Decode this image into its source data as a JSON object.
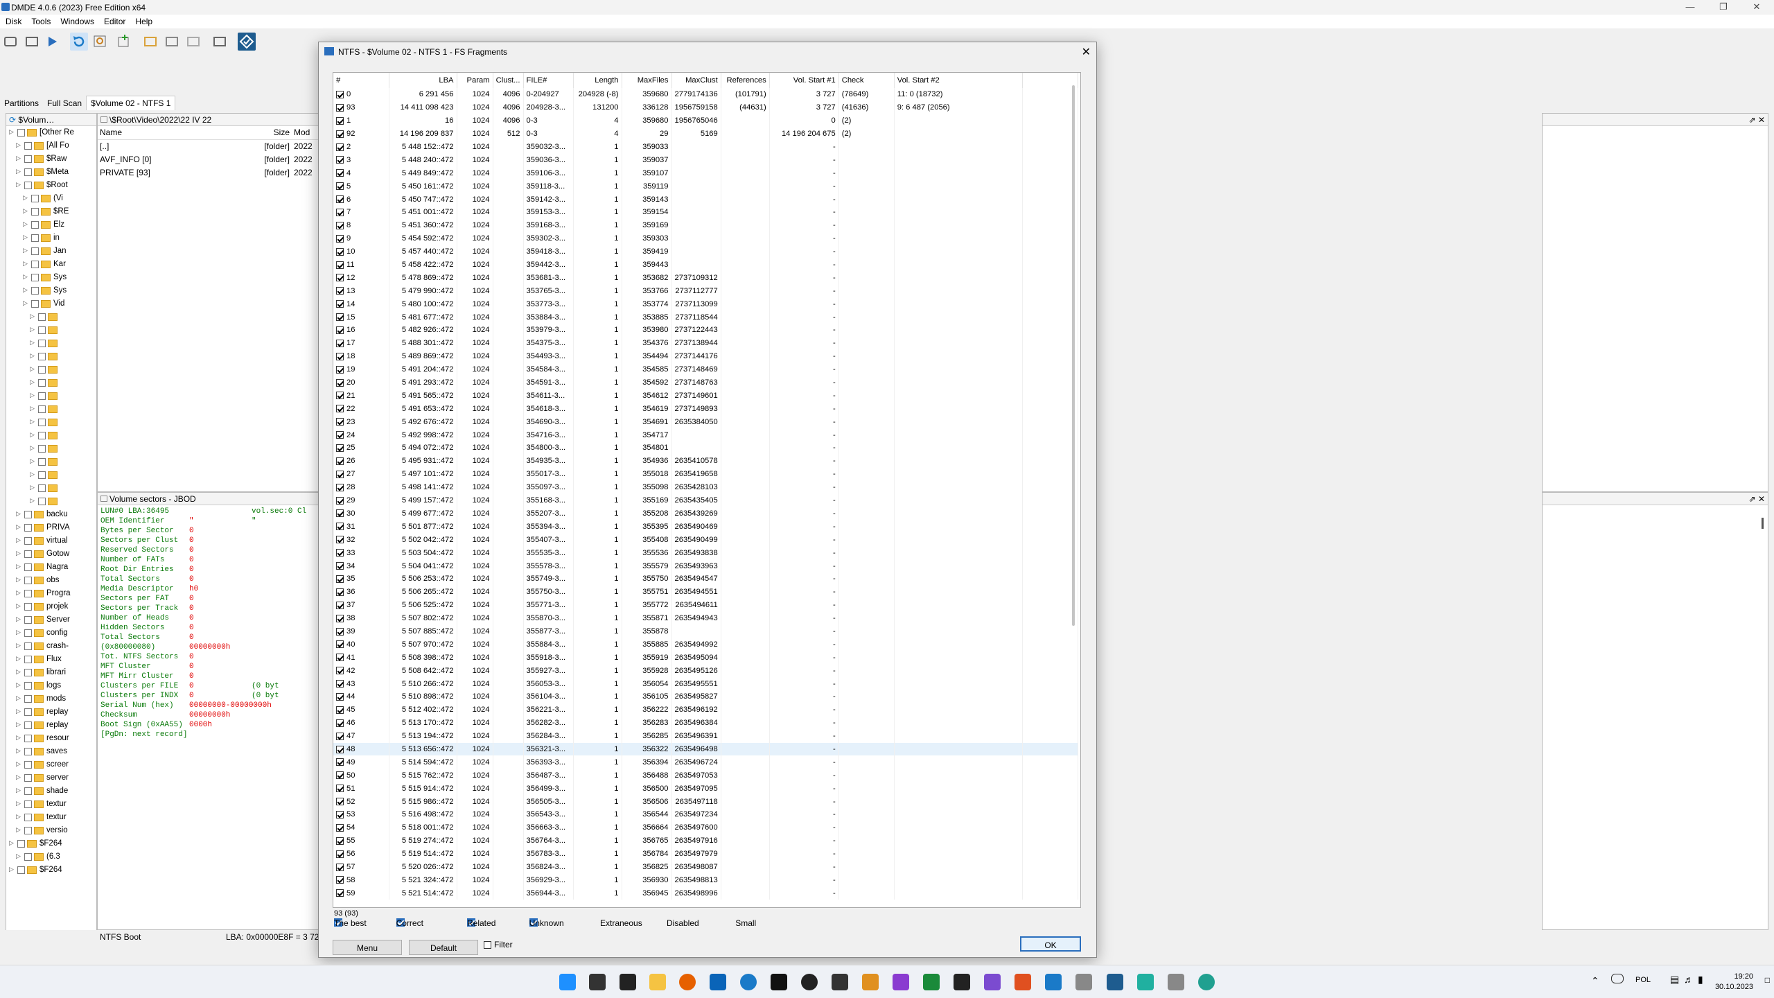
{
  "app": {
    "title": "DMDE 4.0.6 (2023) Free Edition x64"
  },
  "menu": [
    "Disk",
    "Tools",
    "Windows",
    "Editor",
    "Help"
  ],
  "tabs": [
    "Partitions",
    "Full Scan",
    "$Volume 02 - NTFS 1"
  ],
  "tree": {
    "header": "$Volum…",
    "rows": [
      {
        "i": 0,
        "t": "[Other Re"
      },
      {
        "i": 1,
        "t": "[All Fo"
      },
      {
        "i": 1,
        "t": "$Raw"
      },
      {
        "i": 1,
        "t": "$Meta"
      },
      {
        "i": 1,
        "t": "$Root"
      },
      {
        "i": 2,
        "t": "(Vi"
      },
      {
        "i": 2,
        "t": "$RE"
      },
      {
        "i": 2,
        "t": "Elz"
      },
      {
        "i": 2,
        "t": "in"
      },
      {
        "i": 2,
        "t": "Jan"
      },
      {
        "i": 2,
        "t": "Kar"
      },
      {
        "i": 2,
        "t": "Sys"
      },
      {
        "i": 2,
        "t": "Sys"
      },
      {
        "i": 2,
        "t": "Vid"
      },
      {
        "i": 3,
        "t": ""
      },
      {
        "i": 3,
        "t": ""
      },
      {
        "i": 3,
        "t": ""
      },
      {
        "i": 3,
        "t": ""
      },
      {
        "i": 3,
        "t": ""
      },
      {
        "i": 3,
        "t": ""
      },
      {
        "i": 3,
        "t": ""
      },
      {
        "i": 3,
        "t": ""
      },
      {
        "i": 3,
        "t": ""
      },
      {
        "i": 3,
        "t": ""
      },
      {
        "i": 3,
        "t": ""
      },
      {
        "i": 3,
        "t": ""
      },
      {
        "i": 3,
        "t": ""
      },
      {
        "i": 3,
        "t": ""
      },
      {
        "i": 3,
        "t": ""
      },
      {
        "i": 1,
        "t": "backu"
      },
      {
        "i": 1,
        "t": "PRIVA"
      },
      {
        "i": 1,
        "t": "virtual"
      },
      {
        "i": 1,
        "t": "Gotow"
      },
      {
        "i": 1,
        "t": "Nagra"
      },
      {
        "i": 1,
        "t": "obs"
      },
      {
        "i": 1,
        "t": "Progra"
      },
      {
        "i": 1,
        "t": "projek"
      },
      {
        "i": 1,
        "t": "Server"
      },
      {
        "i": 1,
        "t": "config"
      },
      {
        "i": 1,
        "t": "crash-"
      },
      {
        "i": 1,
        "t": "Flux"
      },
      {
        "i": 1,
        "t": "librari"
      },
      {
        "i": 1,
        "t": "logs"
      },
      {
        "i": 1,
        "t": "mods"
      },
      {
        "i": 1,
        "t": "replay"
      },
      {
        "i": 1,
        "t": "replay"
      },
      {
        "i": 1,
        "t": "resour"
      },
      {
        "i": 1,
        "t": "saves"
      },
      {
        "i": 1,
        "t": "screer"
      },
      {
        "i": 1,
        "t": "server"
      },
      {
        "i": 1,
        "t": "shade"
      },
      {
        "i": 1,
        "t": "textur"
      },
      {
        "i": 1,
        "t": "textur"
      },
      {
        "i": 1,
        "t": "versio"
      },
      {
        "i": 0,
        "t": "$F264"
      },
      {
        "i": 1,
        "t": "(6.3"
      },
      {
        "i": 0,
        "t": "$F264"
      }
    ]
  },
  "files": {
    "path": "\\$Root\\Video\\2022\\22 IV 22",
    "cols": [
      "Name",
      "Size",
      "Mod"
    ],
    "rows": [
      {
        "name": "[..]",
        "size": "[folder]",
        "mod": "2022"
      },
      {
        "name": "AVF_INFO [0]",
        "size": "[folder]",
        "mod": "2022"
      },
      {
        "name": "PRIVATE [93]",
        "size": "[folder]",
        "mod": "2022"
      }
    ]
  },
  "sectors": {
    "title": "Volume sectors - JBOD",
    "lines": [
      {
        "a": "LUN#0 LBA:36495",
        "b": "",
        "c": "vol.sec:0 Cl"
      },
      {
        "a": "OEM Identifier",
        "b": "\"",
        "c": "\""
      },
      {
        "a": "Bytes per Sector",
        "b": "0",
        "c": ""
      },
      {
        "a": "Sectors per Clust",
        "b": "0",
        "c": ""
      },
      {
        "a": "Reserved Sectors",
        "b": "0",
        "c": ""
      },
      {
        "a": "Number of FATs",
        "b": "0",
        "c": ""
      },
      {
        "a": "Root Dir Entries",
        "b": "0",
        "c": ""
      },
      {
        "a": "Total Sectors",
        "b": "0",
        "c": ""
      },
      {
        "a": "Media Descriptor",
        "b": "h0",
        "c": ""
      },
      {
        "a": "Sectors per FAT",
        "b": "0",
        "c": ""
      },
      {
        "a": "Sectors per Track",
        "b": "0",
        "c": ""
      },
      {
        "a": "Number of Heads",
        "b": "0",
        "c": ""
      },
      {
        "a": "Hidden Sectors",
        "b": "0",
        "c": ""
      },
      {
        "a": "Total Sectors",
        "b": "0",
        "c": ""
      },
      {
        "a": "(0x80000080)",
        "b": "00000000h",
        "c": ""
      },
      {
        "a": "Tot. NTFS Sectors",
        "b": "0",
        "c": ""
      },
      {
        "a": "MFT Cluster",
        "b": "0",
        "c": ""
      },
      {
        "a": "MFT Mirr Cluster",
        "b": "0",
        "c": ""
      },
      {
        "a": "Clusters per FILE",
        "b": "0",
        "c": "(0 byt"
      },
      {
        "a": "Clusters per INDX",
        "b": "0",
        "c": "(0 byt"
      },
      {
        "a": "Serial Num (hex)",
        "b": "00000000-00000000h",
        "c": ""
      },
      {
        "a": "Checksum",
        "b": "00000000h",
        "c": ""
      },
      {
        "a": "Boot Sign (0xAA55)",
        "b": "0000h",
        "c": ""
      },
      {
        "a": "[PgDn: next record]",
        "b": "",
        "c": ""
      }
    ]
  },
  "statusbar": {
    "left": "NTFS Boot",
    "mid": "LBA: 0x00000E8F = 3 727"
  },
  "dialog": {
    "title": "NTFS - $Volume 02 - NTFS 1 - FS Fragments",
    "cols": [
      "#",
      "LBA",
      "Param",
      "Clust...",
      "FILE#",
      "Length",
      "MaxFiles",
      "MaxClust",
      "References",
      "Vol. Start #1",
      "Check",
      "Vol. Start #2"
    ],
    "rows": [
      [
        "0",
        "6 291 456",
        "1024",
        "4096",
        "0-204927",
        "204928 (-8)",
        "359680",
        "2779174136",
        "(101791)",
        "3 727",
        "(78649)",
        "11: 0 (18732)"
      ],
      [
        "93",
        "14 411 098 423",
        "1024",
        "4096",
        "204928-3...",
        "131200",
        "336128",
        "1956759158",
        "(44631)",
        "3 727",
        "(41636)",
        "9: 6 487 (2056)"
      ],
      [
        "1",
        "16",
        "1024",
        "4096",
        "0-3",
        "4",
        "359680",
        "1956765046",
        "",
        "0",
        "(2)",
        ""
      ],
      [
        "92",
        "14 196 209 837",
        "1024",
        "512",
        "0-3",
        "4",
        "29",
        "5169",
        "",
        "14 196 204 675",
        "(2)",
        ""
      ],
      [
        "2",
        "5 448 152::472",
        "1024",
        "",
        "359032-3...",
        "1",
        "359033",
        "",
        "",
        "-",
        "",
        ""
      ],
      [
        "3",
        "5 448 240::472",
        "1024",
        "",
        "359036-3...",
        "1",
        "359037",
        "",
        "",
        "-",
        "",
        ""
      ],
      [
        "4",
        "5 449 849::472",
        "1024",
        "",
        "359106-3...",
        "1",
        "359107",
        "",
        "",
        "-",
        "",
        ""
      ],
      [
        "5",
        "5 450 161::472",
        "1024",
        "",
        "359118-3...",
        "1",
        "359119",
        "",
        "",
        "-",
        "",
        ""
      ],
      [
        "6",
        "5 450 747::472",
        "1024",
        "",
        "359142-3...",
        "1",
        "359143",
        "",
        "",
        "-",
        "",
        ""
      ],
      [
        "7",
        "5 451 001::472",
        "1024",
        "",
        "359153-3...",
        "1",
        "359154",
        "",
        "",
        "-",
        "",
        ""
      ],
      [
        "8",
        "5 451 360::472",
        "1024",
        "",
        "359168-3...",
        "1",
        "359169",
        "",
        "",
        "-",
        "",
        ""
      ],
      [
        "9",
        "5 454 592::472",
        "1024",
        "",
        "359302-3...",
        "1",
        "359303",
        "",
        "",
        "-",
        "",
        ""
      ],
      [
        "10",
        "5 457 440::472",
        "1024",
        "",
        "359418-3...",
        "1",
        "359419",
        "",
        "",
        "-",
        "",
        ""
      ],
      [
        "11",
        "5 458 422::472",
        "1024",
        "",
        "359442-3...",
        "1",
        "359443",
        "",
        "",
        "-",
        "",
        ""
      ],
      [
        "12",
        "5 478 869::472",
        "1024",
        "",
        "353681-3...",
        "1",
        "353682",
        "2737109312",
        "",
        "-",
        "",
        ""
      ],
      [
        "13",
        "5 479 990::472",
        "1024",
        "",
        "353765-3...",
        "1",
        "353766",
        "2737112777",
        "",
        "-",
        "",
        ""
      ],
      [
        "14",
        "5 480 100::472",
        "1024",
        "",
        "353773-3...",
        "1",
        "353774",
        "2737113099",
        "",
        "-",
        "",
        ""
      ],
      [
        "15",
        "5 481 677::472",
        "1024",
        "",
        "353884-3...",
        "1",
        "353885",
        "2737118544",
        "",
        "-",
        "",
        ""
      ],
      [
        "16",
        "5 482 926::472",
        "1024",
        "",
        "353979-3...",
        "1",
        "353980",
        "2737122443",
        "",
        "-",
        "",
        ""
      ],
      [
        "17",
        "5 488 301::472",
        "1024",
        "",
        "354375-3...",
        "1",
        "354376",
        "2737138944",
        "",
        "-",
        "",
        ""
      ],
      [
        "18",
        "5 489 869::472",
        "1024",
        "",
        "354493-3...",
        "1",
        "354494",
        "2737144176",
        "",
        "-",
        "",
        ""
      ],
      [
        "19",
        "5 491 204::472",
        "1024",
        "",
        "354584-3...",
        "1",
        "354585",
        "2737148469",
        "",
        "-",
        "",
        ""
      ],
      [
        "20",
        "5 491 293::472",
        "1024",
        "",
        "354591-3...",
        "1",
        "354592",
        "2737148763",
        "",
        "-",
        "",
        ""
      ],
      [
        "21",
        "5 491 565::472",
        "1024",
        "",
        "354611-3...",
        "1",
        "354612",
        "2737149601",
        "",
        "-",
        "",
        ""
      ],
      [
        "22",
        "5 491 653::472",
        "1024",
        "",
        "354618-3...",
        "1",
        "354619",
        "2737149893",
        "",
        "-",
        "",
        ""
      ],
      [
        "23",
        "5 492 676::472",
        "1024",
        "",
        "354690-3...",
        "1",
        "354691",
        "2635384050",
        "",
        "-",
        "",
        ""
      ],
      [
        "24",
        "5 492 998::472",
        "1024",
        "",
        "354716-3...",
        "1",
        "354717",
        "",
        "",
        "-",
        "",
        ""
      ],
      [
        "25",
        "5 494 072::472",
        "1024",
        "",
        "354800-3...",
        "1",
        "354801",
        "",
        "",
        "-",
        "",
        ""
      ],
      [
        "26",
        "5 495 931::472",
        "1024",
        "",
        "354935-3...",
        "1",
        "354936",
        "2635410578",
        "",
        "-",
        "",
        ""
      ],
      [
        "27",
        "5 497 101::472",
        "1024",
        "",
        "355017-3...",
        "1",
        "355018",
        "2635419658",
        "",
        "-",
        "",
        ""
      ],
      [
        "28",
        "5 498 141::472",
        "1024",
        "",
        "355097-3...",
        "1",
        "355098",
        "2635428103",
        "",
        "-",
        "",
        ""
      ],
      [
        "29",
        "5 499 157::472",
        "1024",
        "",
        "355168-3...",
        "1",
        "355169",
        "2635435405",
        "",
        "-",
        "",
        ""
      ],
      [
        "30",
        "5 499 677::472",
        "1024",
        "",
        "355207-3...",
        "1",
        "355208",
        "2635439269",
        "",
        "-",
        "",
        ""
      ],
      [
        "31",
        "5 501 877::472",
        "1024",
        "",
        "355394-3...",
        "1",
        "355395",
        "2635490469",
        "",
        "-",
        "",
        ""
      ],
      [
        "32",
        "5 502 042::472",
        "1024",
        "",
        "355407-3...",
        "1",
        "355408",
        "2635490499",
        "",
        "-",
        "",
        ""
      ],
      [
        "33",
        "5 503 504::472",
        "1024",
        "",
        "355535-3...",
        "1",
        "355536",
        "2635493838",
        "",
        "-",
        "",
        ""
      ],
      [
        "34",
        "5 504 041::472",
        "1024",
        "",
        "355578-3...",
        "1",
        "355579",
        "2635493963",
        "",
        "-",
        "",
        ""
      ],
      [
        "35",
        "5 506 253::472",
        "1024",
        "",
        "355749-3...",
        "1",
        "355750",
        "2635494547",
        "",
        "-",
        "",
        ""
      ],
      [
        "36",
        "5 506 265::472",
        "1024",
        "",
        "355750-3...",
        "1",
        "355751",
        "2635494551",
        "",
        "-",
        "",
        ""
      ],
      [
        "37",
        "5 506 525::472",
        "1024",
        "",
        "355771-3...",
        "1",
        "355772",
        "2635494611",
        "",
        "-",
        "",
        ""
      ],
      [
        "38",
        "5 507 802::472",
        "1024",
        "",
        "355870-3...",
        "1",
        "355871",
        "2635494943",
        "",
        "-",
        "",
        ""
      ],
      [
        "39",
        "5 507 885::472",
        "1024",
        "",
        "355877-3...",
        "1",
        "355878",
        "",
        "",
        "-",
        "",
        ""
      ],
      [
        "40",
        "5 507 970::472",
        "1024",
        "",
        "355884-3...",
        "1",
        "355885",
        "2635494992",
        "",
        "-",
        "",
        ""
      ],
      [
        "41",
        "5 508 398::472",
        "1024",
        "",
        "355918-3...",
        "1",
        "355919",
        "2635495094",
        "",
        "-",
        "",
        ""
      ],
      [
        "42",
        "5 508 642::472",
        "1024",
        "",
        "355927-3...",
        "1",
        "355928",
        "2635495126",
        "",
        "-",
        "",
        ""
      ],
      [
        "43",
        "5 510 266::472",
        "1024",
        "",
        "356053-3...",
        "1",
        "356054",
        "2635495551",
        "",
        "-",
        "",
        ""
      ],
      [
        "44",
        "5 510 898::472",
        "1024",
        "",
        "356104-3...",
        "1",
        "356105",
        "2635495827",
        "",
        "-",
        "",
        ""
      ],
      [
        "45",
        "5 512 402::472",
        "1024",
        "",
        "356221-3...",
        "1",
        "356222",
        "2635496192",
        "",
        "-",
        "",
        ""
      ],
      [
        "46",
        "5 513 170::472",
        "1024",
        "",
        "356282-3...",
        "1",
        "356283",
        "2635496384",
        "",
        "-",
        "",
        ""
      ],
      [
        "47",
        "5 513 194::472",
        "1024",
        "",
        "356284-3...",
        "1",
        "356285",
        "2635496391",
        "",
        "-",
        "",
        ""
      ],
      [
        "48",
        "5 513 656::472",
        "1024",
        "",
        "356321-3...",
        "1",
        "356322",
        "2635496498",
        "",
        "-",
        "",
        ""
      ],
      [
        "49",
        "5 514 594::472",
        "1024",
        "",
        "356393-3...",
        "1",
        "356394",
        "2635496724",
        "",
        "-",
        "",
        ""
      ],
      [
        "50",
        "5 515 762::472",
        "1024",
        "",
        "356487-3...",
        "1",
        "356488",
        "2635497053",
        "",
        "-",
        "",
        ""
      ],
      [
        "51",
        "5 515 914::472",
        "1024",
        "",
        "356499-3...",
        "1",
        "356500",
        "2635497095",
        "",
        "-",
        "",
        ""
      ],
      [
        "52",
        "5 515 986::472",
        "1024",
        "",
        "356505-3...",
        "1",
        "356506",
        "2635497118",
        "",
        "-",
        "",
        ""
      ],
      [
        "53",
        "5 516 498::472",
        "1024",
        "",
        "356543-3...",
        "1",
        "356544",
        "2635497234",
        "",
        "-",
        "",
        ""
      ],
      [
        "54",
        "5 518 001::472",
        "1024",
        "",
        "356663-3...",
        "1",
        "356664",
        "2635497600",
        "",
        "-",
        "",
        ""
      ],
      [
        "55",
        "5 519 274::472",
        "1024",
        "",
        "356764-3...",
        "1",
        "356765",
        "2635497916",
        "",
        "-",
        "",
        ""
      ],
      [
        "56",
        "5 519 514::472",
        "1024",
        "",
        "356783-3...",
        "1",
        "356784",
        "2635497979",
        "",
        "-",
        "",
        ""
      ],
      [
        "57",
        "5 520 026::472",
        "1024",
        "",
        "356824-3...",
        "1",
        "356825",
        "2635498087",
        "",
        "-",
        "",
        ""
      ],
      [
        "58",
        "5 521 324::472",
        "1024",
        "",
        "356929-3...",
        "1",
        "356930",
        "2635498813",
        "",
        "-",
        "",
        ""
      ],
      [
        "59",
        "5 521 514::472",
        "1024",
        "",
        "356944-3...",
        "1",
        "356945",
        "2635498996",
        "",
        "-",
        "",
        ""
      ]
    ],
    "count": "93 (93)",
    "categories": [
      {
        "label": "The best",
        "checked": true
      },
      {
        "label": "Correct",
        "checked": true
      },
      {
        "label": "Related",
        "checked": true
      },
      {
        "label": "Unknown",
        "checked": true
      },
      {
        "label": "Extraneous",
        "checked": false
      },
      {
        "label": "Disabled",
        "checked": false
      },
      {
        "label": "Small",
        "checked": false
      }
    ],
    "menu_btn": "Menu",
    "default_btn": "Default",
    "filter_label": "Filter",
    "ok_btn": "OK"
  },
  "taskbar": {
    "lang": "POL",
    "time": "19:20",
    "date": "30.10.2023"
  }
}
